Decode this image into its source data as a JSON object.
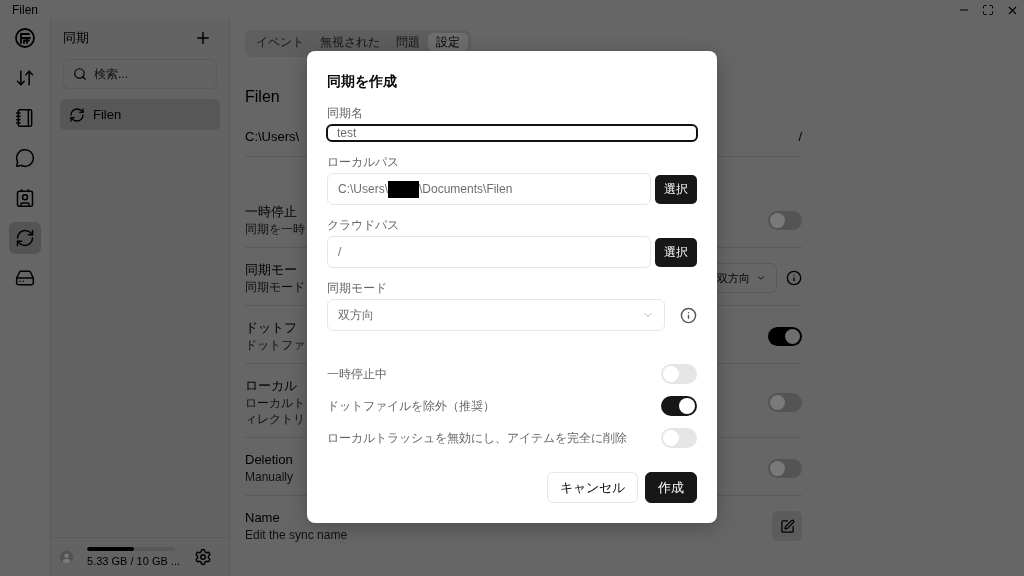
{
  "window": {
    "title": "Filen"
  },
  "rail": {
    "items": [
      {
        "selected": false
      },
      {
        "selected": false
      },
      {
        "selected": false
      },
      {
        "selected": false
      },
      {
        "selected": false
      },
      {
        "selected": true
      },
      {
        "selected": false
      }
    ]
  },
  "sidebar": {
    "title": "同期",
    "search": {
      "placeholder": "検索..."
    },
    "items": [
      {
        "label": "Filen",
        "selected": true
      }
    ],
    "storage": {
      "level": 0.53,
      "text": "5.33 GB / 10 GB ..."
    }
  },
  "main": {
    "tabs": [
      {
        "label": "イベント",
        "selected": false
      },
      {
        "label": "無視された",
        "selected": false
      },
      {
        "label": "問題",
        "selected": false
      },
      {
        "label": "設定",
        "selected": true
      }
    ],
    "title": "Filen",
    "path_row": {
      "local": "C:\\Users\\",
      "remote": "/"
    },
    "settings": [
      {
        "kind": "toggle",
        "title": "一時停止",
        "description": [
          "同期を一時"
        ],
        "on": false
      },
      {
        "kind": "select",
        "title": "同期モー",
        "description": [
          "同期モード"
        ],
        "value": "双方向"
      },
      {
        "kind": "toggle",
        "title": "ドットフ",
        "description": [
          "ドットファ"
        ],
        "on": true
      },
      {
        "kind": "toggle",
        "title": "ローカル",
        "description": [
          "ローカルト",
          "ィレクトリ"
        ],
        "on": false
      },
      {
        "kind": "toggle",
        "title": "Deletion",
        "description": [
          "Manually"
        ],
        "on": false
      },
      {
        "kind": "edit",
        "title": "Name",
        "description": [
          "Edit the sync name"
        ]
      }
    ]
  },
  "dialog": {
    "title": "同期を作成",
    "fields": [
      {
        "kind": "text",
        "label": "同期名",
        "value": "test",
        "focused": true
      },
      {
        "kind": "path",
        "label": "ローカルパス",
        "value": "C:\\Users\\",
        "redacted": true,
        "value_end": "\\Documents\\Filen",
        "focused": false,
        "button": "選択"
      },
      {
        "kind": "path",
        "label": "クラウドパス",
        "value": "/",
        "focused": false,
        "button": "選択"
      },
      {
        "kind": "select",
        "label": "同期モード",
        "value": "双方向",
        "focused": false
      }
    ],
    "toggles": [
      {
        "label": "一時停止中",
        "on": false
      },
      {
        "label": "ドットファイルを除外（推奨）",
        "on": true
      },
      {
        "label": "ローカルトラッシュを無効にし、アイテムを完全に削除",
        "on": false
      }
    ],
    "buttons": [
      {
        "label": "キャンセル",
        "kind": "secondary"
      },
      {
        "label": "作成",
        "kind": "primary"
      }
    ]
  }
}
